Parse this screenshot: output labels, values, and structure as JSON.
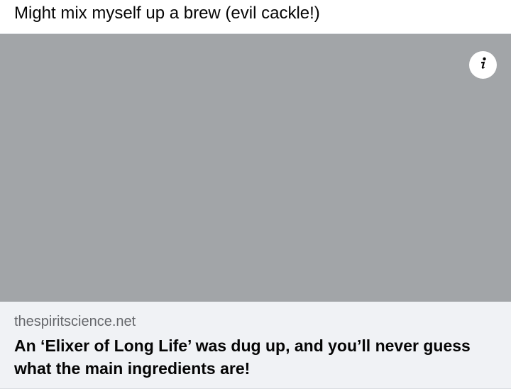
{
  "post": {
    "text": "Might mix myself up a brew (evil cackle!)"
  },
  "link_card": {
    "info_icon": "info-icon",
    "domain": "thespiritscience.net",
    "headline": "An ‘Elixer of Long Life’ was dug up, and you’ll never guess what the main ingredients are!",
    "image_placeholder_color": "#a2a5a8",
    "footer_background": "#f0f2f5"
  }
}
